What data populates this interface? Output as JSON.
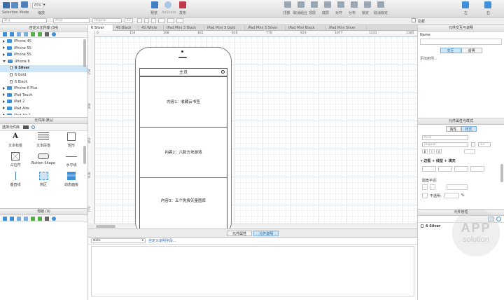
{
  "toolbar": {
    "selection_mode": "Selection Mode",
    "zoom_value": "65%",
    "zoom_label": "缩放",
    "preview": "预览",
    "axshare": "AxShare",
    "publish": "发布",
    "align_tools": [
      "顶部",
      "取消组合",
      "顶层",
      "底层",
      "对齐",
      "分布",
      "锁定",
      "取消锁定"
    ],
    "left": "左",
    "right": "右"
  },
  "format": {
    "default_style": "默认",
    "font": "Arial",
    "weight": "Regular",
    "size": "13",
    "hidden": "隐藏"
  },
  "pages_panel": {
    "title": "自定义元件库 (34)",
    "items": [
      {
        "label": "iPhone 4S",
        "type": "folder",
        "open": false,
        "indent": 0
      },
      {
        "label": "iPhone 5S",
        "type": "folder",
        "open": false,
        "indent": 0
      },
      {
        "label": "iPhone 5S",
        "type": "folder",
        "open": false,
        "indent": 0
      },
      {
        "label": "iPhone 6",
        "type": "folder",
        "open": true,
        "indent": 0
      },
      {
        "label": "6 Silver",
        "type": "page",
        "selected": true,
        "indent": 1
      },
      {
        "label": "6 Gold",
        "type": "page",
        "indent": 1
      },
      {
        "label": "6 Black",
        "type": "page",
        "indent": 1
      },
      {
        "label": "iPhone 6 Plus",
        "type": "folder",
        "open": false,
        "indent": 0
      },
      {
        "label": "iPod Touch",
        "type": "folder",
        "open": false,
        "indent": 0
      },
      {
        "label": "iPad 2",
        "type": "folder",
        "open": false,
        "indent": 0
      },
      {
        "label": "iPad Aire",
        "type": "folder",
        "open": false,
        "indent": 0
      },
      {
        "label": "iPad Air 2",
        "type": "folder",
        "open": false,
        "indent": 0
      }
    ]
  },
  "widgets_panel": {
    "title": "元件库:默认",
    "select_label": "选择元件库",
    "items": [
      {
        "label": "文本标签",
        "icon": "text-label-icon"
      },
      {
        "label": "文本段落",
        "icon": "text-paragraph-icon"
      },
      {
        "label": "矩形",
        "icon": "rectangle-icon"
      },
      {
        "label": "占位符",
        "icon": "placeholder-icon"
      },
      {
        "label": "Button Shape",
        "icon": "button-shape-icon"
      },
      {
        "label": "水平线",
        "icon": "horizontal-line-icon"
      },
      {
        "label": "垂直线",
        "icon": "vertical-line-icon"
      },
      {
        "label": "热区",
        "icon": "hotspot-icon"
      },
      {
        "label": "动态面板",
        "icon": "dynamic-panel-icon"
      }
    ]
  },
  "masters_panel": {
    "title": "母版 (0)"
  },
  "tabs": [
    "6 Silver",
    "4S Black",
    "4S White",
    "iPad Mini 3 Black",
    "iPad Mini 3 Gold",
    "iPad Mini 3 Silver",
    "iPad Mini Black",
    "iPad Mini Silver"
  ],
  "ruler_h": [
    "0",
    "154",
    "308",
    "462",
    "616",
    "770",
    "923",
    "1077",
    "1231",
    "1385"
  ],
  "ruler_v": [
    "154",
    "308",
    "462",
    "616",
    "770"
  ],
  "phone": {
    "nav_title": "主页",
    "cards": [
      "内容1：收藏云书签",
      "内容2：六款方块游戏",
      "内容3：五个免费矢量图库"
    ]
  },
  "bottom_panel": {
    "tabs": [
      "元件属性",
      "元件说明"
    ],
    "active_tab": "元件说明",
    "note_select": "Note",
    "custom_fields_link": "自定义说明字段..."
  },
  "interaction_panel": {
    "title": "元件交互与说明",
    "name_label": "Name",
    "tabs": [
      "交互",
      "说明"
    ],
    "active_tab": "交互",
    "add_case": "添加用例..."
  },
  "style_panel": {
    "title": "元件属性与样式",
    "tabs": [
      "属性",
      "样式"
    ],
    "active_tab": "样式",
    "font": "Arial",
    "weight": "Regular",
    "size": "13",
    "border_section": "边框 + 线型 + 填充",
    "radius_label": "圆角半径:",
    "opacity_label": "不透明:",
    "opacity_unit": "%"
  },
  "outline_panel": {
    "title": "元件管理",
    "root": "6 Silver"
  },
  "watermark": {
    "line1": "APP",
    "line2": "solution"
  },
  "colors": {
    "accent": "#3c8fd8",
    "selection": "#cfe6f8"
  }
}
